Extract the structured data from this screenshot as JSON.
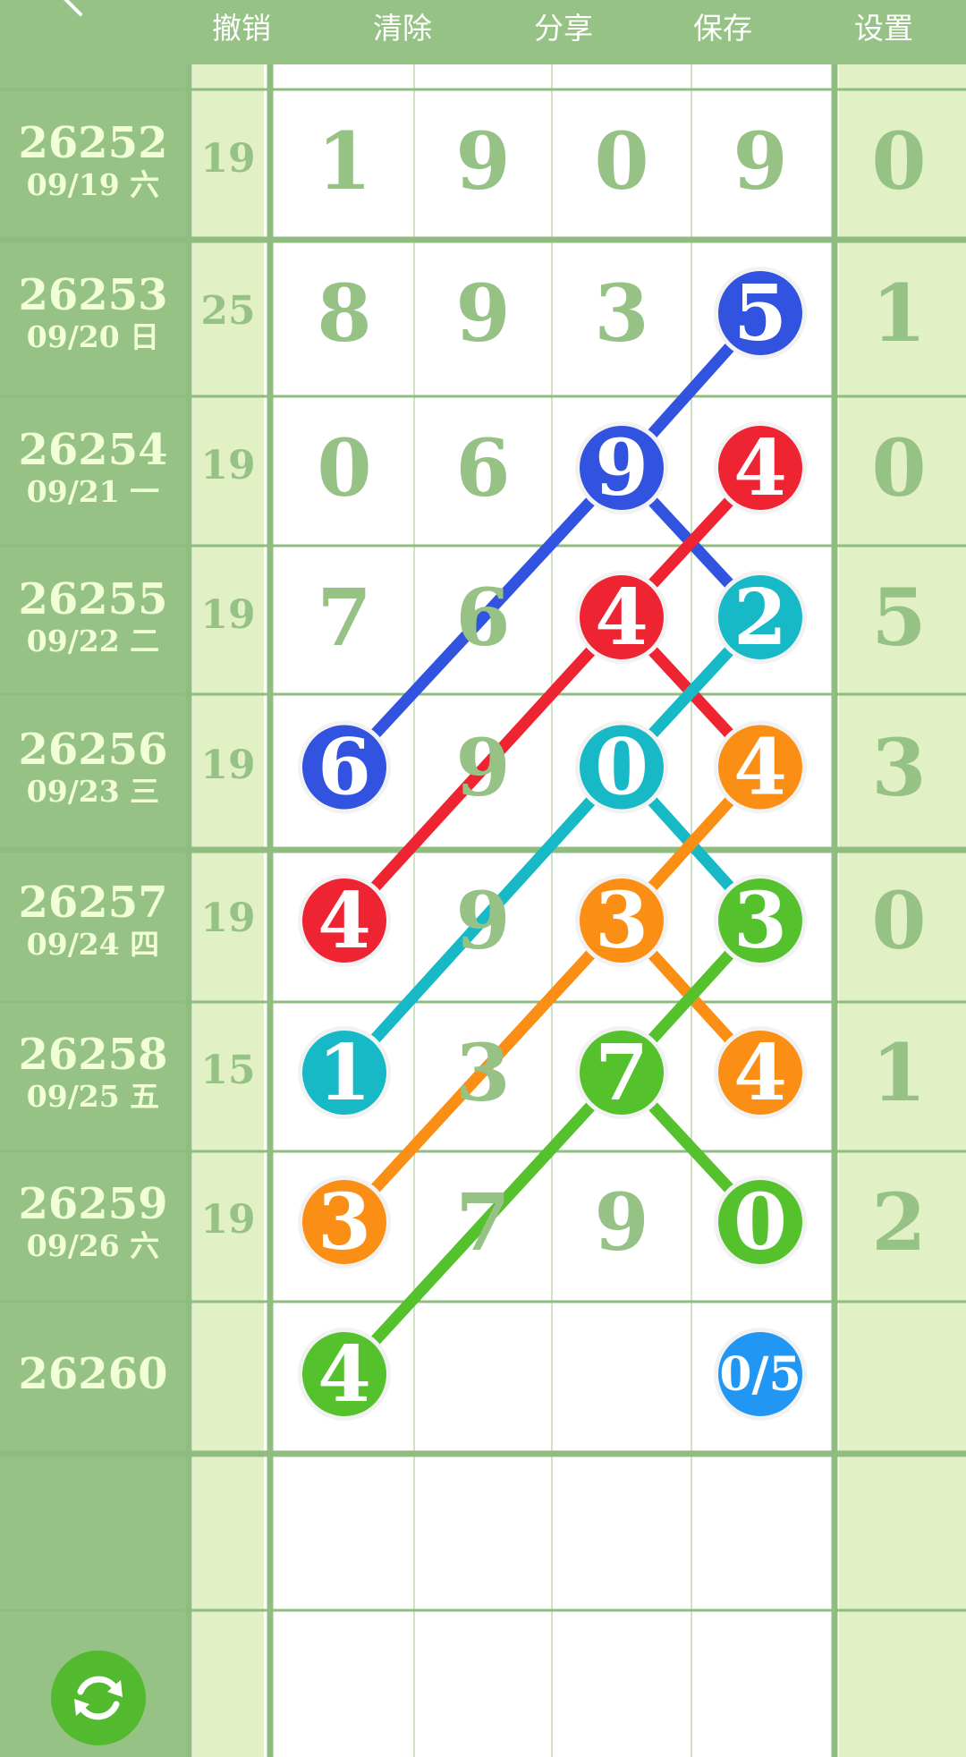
{
  "toolbar": {
    "undo_label": "撤销",
    "clear_label": "清除",
    "share_label": "分享",
    "save_label": "保存",
    "settings_label": "设置"
  },
  "rows": [
    {
      "period": "26252",
      "date": "09/19 六",
      "sum": "19",
      "d1": "1",
      "d2": "9",
      "d3": "0",
      "d4": "9",
      "extra": "0"
    },
    {
      "period": "26253",
      "date": "09/20 日",
      "sum": "25",
      "d1": "8",
      "d2": "9",
      "d3": "3",
      "d4": "5",
      "extra": "1"
    },
    {
      "period": "26254",
      "date": "09/21 一",
      "sum": "19",
      "d1": "0",
      "d2": "6",
      "d3": "9",
      "d4": "4",
      "extra": "0"
    },
    {
      "period": "26255",
      "date": "09/22 二",
      "sum": "19",
      "d1": "7",
      "d2": "6",
      "d3": "4",
      "d4": "2",
      "extra": "5"
    },
    {
      "period": "26256",
      "date": "09/23 三",
      "sum": "19",
      "d1": "6",
      "d2": "9",
      "d3": "0",
      "d4": "4",
      "extra": "3"
    },
    {
      "period": "26257",
      "date": "09/24 四",
      "sum": "19",
      "d1": "4",
      "d2": "9",
      "d3": "3",
      "d4": "3",
      "extra": "0"
    },
    {
      "period": "26258",
      "date": "09/25 五",
      "sum": "15",
      "d1": "1",
      "d2": "3",
      "d3": "7",
      "d4": "4",
      "extra": "1"
    },
    {
      "period": "26259",
      "date": "09/26 六",
      "sum": "19",
      "d1": "3",
      "d2": "7",
      "d3": "9",
      "d4": "0",
      "extra": "2"
    },
    {
      "period": "26260",
      "date": "",
      "sum": "",
      "d1": "4",
      "d2": "",
      "d3": "",
      "d4": "0/5",
      "extra": ""
    }
  ],
  "colors": {
    "blue": "#3252e0",
    "red": "#ee2432",
    "cyan": "#18b9c6",
    "orange": "#fb8f15",
    "green": "#54c12d",
    "counter": "#2196f3",
    "grid_green": "#97c285",
    "light_column": "#e2f0c6"
  },
  "chains": [
    {
      "color": "blue",
      "marks": [
        {
          "row": 1,
          "col": 4
        },
        {
          "row": 2,
          "col": 3
        },
        {
          "row": 3,
          "col": 4
        }
      ]
    },
    {
      "color": "blue",
      "marks": [
        {
          "row": 2,
          "col": 3
        },
        {
          "row": 4,
          "col": 1
        }
      ]
    },
    {
      "color": "red",
      "marks": [
        {
          "row": 2,
          "col": 4
        },
        {
          "row": 3,
          "col": 3
        },
        {
          "row": 4,
          "col": 4
        }
      ]
    },
    {
      "color": "red",
      "marks": [
        {
          "row": 3,
          "col": 3
        },
        {
          "row": 5,
          "col": 1
        }
      ]
    },
    {
      "color": "cyan",
      "marks": [
        {
          "row": 3,
          "col": 4
        },
        {
          "row": 4,
          "col": 3
        },
        {
          "row": 5,
          "col": 4
        }
      ]
    },
    {
      "color": "cyan",
      "marks": [
        {
          "row": 4,
          "col": 3
        },
        {
          "row": 6,
          "col": 1
        }
      ]
    },
    {
      "color": "orange",
      "marks": [
        {
          "row": 4,
          "col": 4
        },
        {
          "row": 5,
          "col": 3
        },
        {
          "row": 6,
          "col": 4
        }
      ]
    },
    {
      "color": "orange",
      "marks": [
        {
          "row": 5,
          "col": 3
        },
        {
          "row": 7,
          "col": 1
        }
      ]
    },
    {
      "color": "green",
      "marks": [
        {
          "row": 5,
          "col": 4
        },
        {
          "row": 6,
          "col": 3
        },
        {
          "row": 7,
          "col": 4
        }
      ]
    },
    {
      "color": "green",
      "marks": [
        {
          "row": 6,
          "col": 3
        },
        {
          "row": 8,
          "col": 1
        }
      ]
    }
  ],
  "balls": [
    {
      "row": 1,
      "col": 4,
      "color": "blue",
      "label": "5"
    },
    {
      "row": 2,
      "col": 3,
      "color": "blue",
      "label": "9"
    },
    {
      "row": 2,
      "col": 4,
      "color": "red",
      "label": "4"
    },
    {
      "row": 3,
      "col": 3,
      "color": "red",
      "label": "4"
    },
    {
      "row": 3,
      "col": 4,
      "color": "cyan",
      "label": "2"
    },
    {
      "row": 4,
      "col": 1,
      "color": "blue",
      "label": "6"
    },
    {
      "row": 4,
      "col": 3,
      "color": "cyan",
      "label": "0"
    },
    {
      "row": 4,
      "col": 4,
      "color": "orange",
      "label": "4"
    },
    {
      "row": 5,
      "col": 1,
      "color": "red",
      "label": "4"
    },
    {
      "row": 5,
      "col": 3,
      "color": "orange",
      "label": "3"
    },
    {
      "row": 5,
      "col": 4,
      "color": "green",
      "label": "3"
    },
    {
      "row": 6,
      "col": 1,
      "color": "cyan",
      "label": "1"
    },
    {
      "row": 6,
      "col": 3,
      "color": "green",
      "label": "7"
    },
    {
      "row": 6,
      "col": 4,
      "color": "orange",
      "label": "4"
    },
    {
      "row": 7,
      "col": 1,
      "color": "orange",
      "label": "3"
    },
    {
      "row": 7,
      "col": 4,
      "color": "green",
      "label": "0"
    },
    {
      "row": 8,
      "col": 1,
      "color": "green",
      "label": "4"
    },
    {
      "row": 8,
      "col": 4,
      "color": "counter",
      "label": "0/5"
    }
  ]
}
